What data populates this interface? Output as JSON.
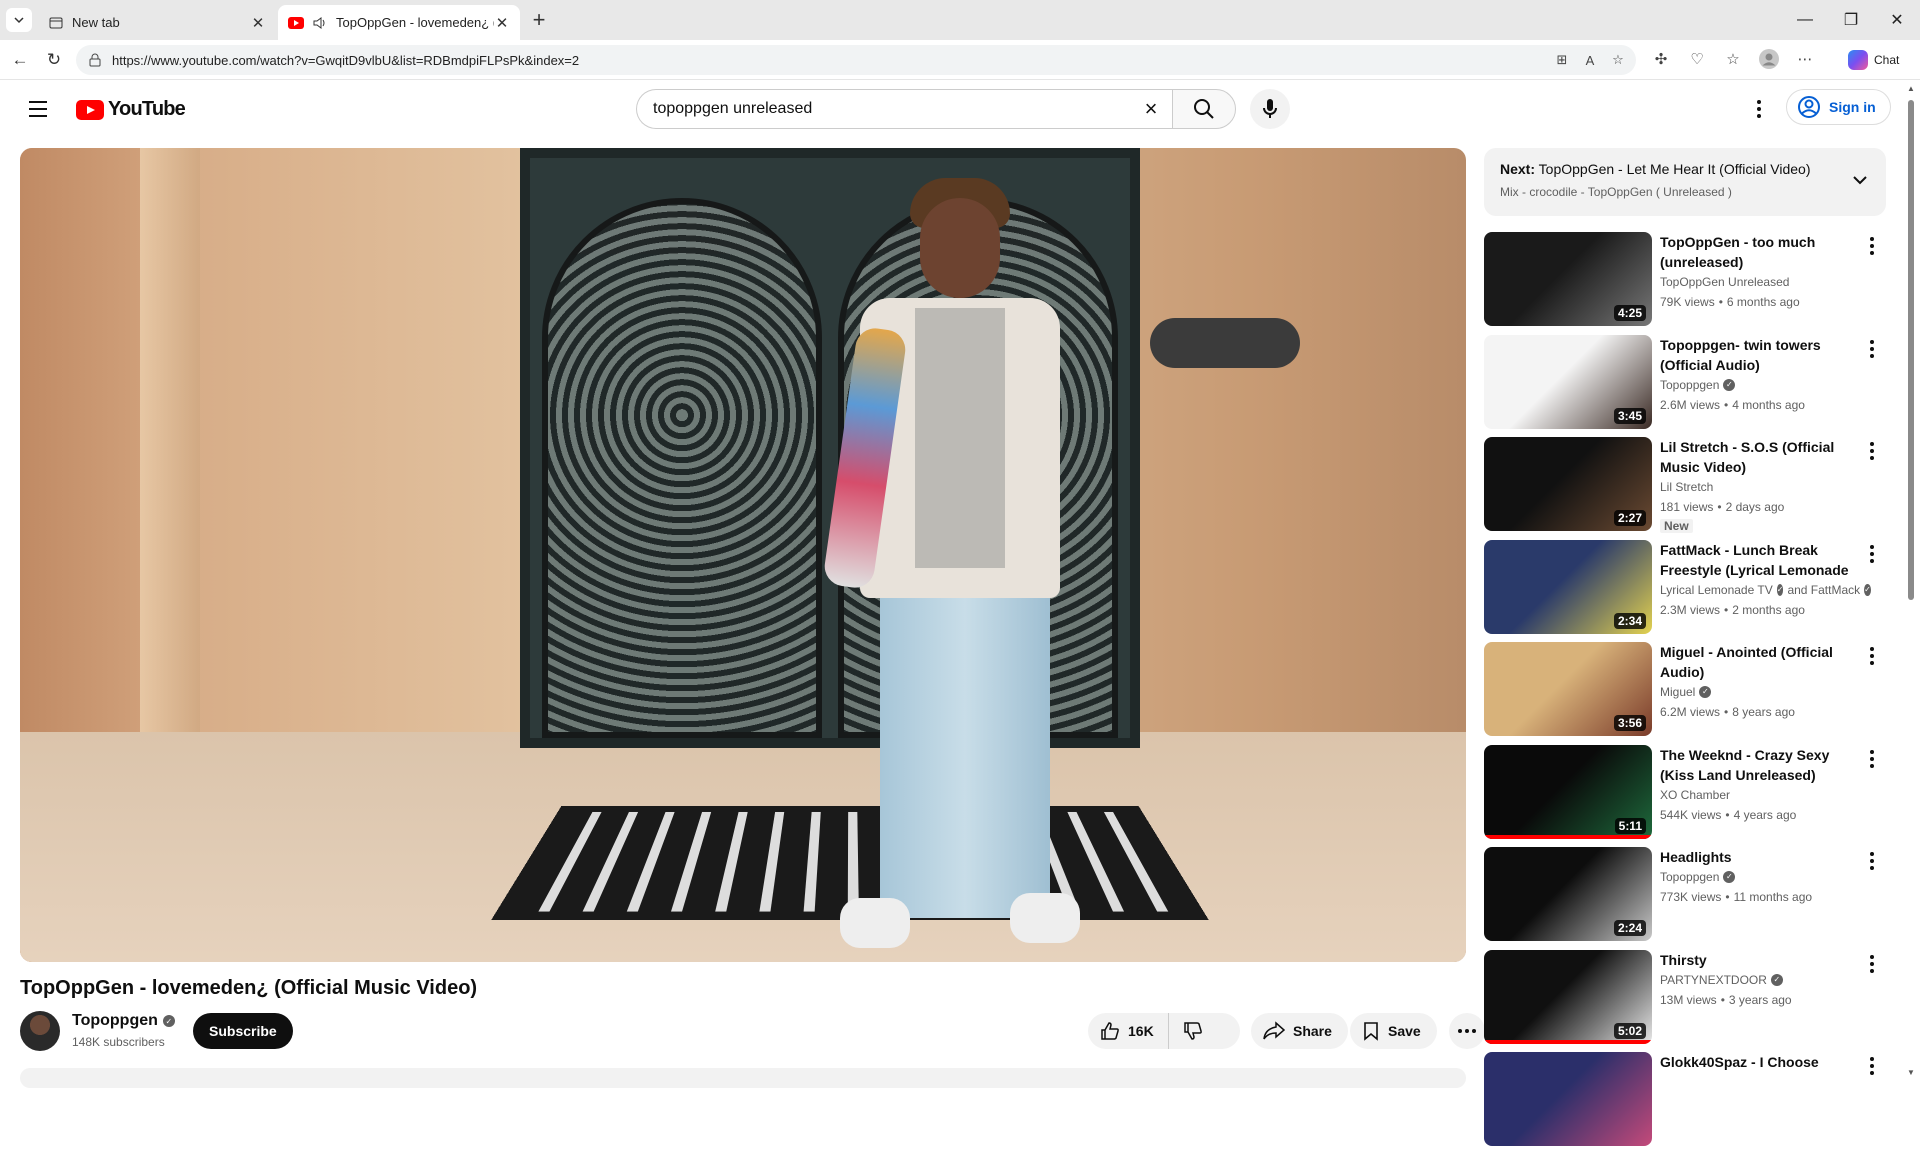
{
  "browser": {
    "tabs": [
      {
        "title": "New tab",
        "active": false
      },
      {
        "title": "TopOppGen - lovemeden¿ (Of",
        "active": true
      }
    ],
    "url": "https://www.youtube.com/watch?v=GwqitD9vlbU&list=RDBmdpiFLPsPk&index=2",
    "chat_label": "Chat"
  },
  "header": {
    "logo_text": "YouTube",
    "search_value": "topoppgen unreleased",
    "signin_label": "Sign in"
  },
  "video": {
    "title": "TopOppGen - lovemeden¿ (Official Music Video)",
    "channel": "Topoppgen",
    "subscribers": "148K subscribers",
    "subscribe_label": "Subscribe",
    "likes": "16K",
    "share_label": "Share",
    "save_label": "Save"
  },
  "next": {
    "prefix": "Next:",
    "title": "TopOppGen - Let Me Hear It (Official Video)",
    "playlist": "Mix - crocodile - TopOppGen ( Unreleased )"
  },
  "recommendations": [
    {
      "title": "TopOppGen -  too much (unreleased)",
      "channel": "TopOppGen Unreleased",
      "verified": false,
      "extra": "",
      "views": "79K views",
      "age": "6 months ago",
      "duration": "4:25",
      "badge": "",
      "progress": 0,
      "colors": [
        "#1a1a1a",
        "#777777"
      ]
    },
    {
      "title": "Topoppgen- twin towers (Official Audio)",
      "channel": "Topoppgen",
      "verified": true,
      "extra": "",
      "views": "2.6M views",
      "age": "4 months ago",
      "duration": "3:45",
      "badge": "",
      "progress": 0,
      "colors": [
        "#f4f4f4",
        "#3a2a24"
      ]
    },
    {
      "title": "Lil Stretch - S.O.S (Official Music Video)",
      "channel": "Lil Stretch",
      "verified": false,
      "extra": "",
      "views": "181 views",
      "age": "2 days ago",
      "duration": "2:27",
      "badge": "New",
      "progress": 0,
      "colors": [
        "#111111",
        "#6b4a32"
      ]
    },
    {
      "title": "FattMack - Lunch Break Freestyle (Lyrical Lemonade ...",
      "channel": "Lyrical Lemonade TV",
      "verified": true,
      "extra": "and FattMack",
      "views": "2.3M views",
      "age": "2 months ago",
      "duration": "2:34",
      "badge": "",
      "progress": 0,
      "colors": [
        "#2a3a6a",
        "#e3d250"
      ]
    },
    {
      "title": "Miguel - Anointed (Official Audio)",
      "channel": "Miguel",
      "verified": true,
      "extra": "",
      "views": "6.2M views",
      "age": "8 years ago",
      "duration": "3:56",
      "badge": "",
      "progress": 0,
      "colors": [
        "#d8b27a",
        "#7a3b2a"
      ]
    },
    {
      "title": "The Weeknd - Crazy Sexy (Kiss Land Unreleased)",
      "channel": "XO Chamber",
      "verified": false,
      "extra": "",
      "views": "544K views",
      "age": "4 years ago",
      "duration": "5:11",
      "badge": "",
      "progress": 1,
      "colors": [
        "#0a0a0a",
        "#1e6a3c"
      ]
    },
    {
      "title": "Headlights",
      "channel": "Topoppgen",
      "verified": true,
      "extra": "",
      "views": "773K views",
      "age": "11 months ago",
      "duration": "2:24",
      "badge": "",
      "progress": 0,
      "colors": [
        "#0d0d0d",
        "#c9c9c9"
      ]
    },
    {
      "title": "Thirsty",
      "channel": "PARTYNEXTDOOR",
      "verified": true,
      "extra": "",
      "views": "13M views",
      "age": "3 years ago",
      "duration": "5:02",
      "badge": "",
      "progress": 1,
      "colors": [
        "#101010",
        "#e8e8e8"
      ]
    },
    {
      "title": "Glokk40Spaz - I Choose",
      "channel": "",
      "verified": false,
      "extra": "",
      "views": "",
      "age": "",
      "duration": "",
      "badge": "",
      "progress": 0,
      "colors": [
        "#2b2f6a",
        "#c44a7a"
      ]
    }
  ],
  "colors": {
    "accent": "#ff0000",
    "link": "#065fd4"
  }
}
